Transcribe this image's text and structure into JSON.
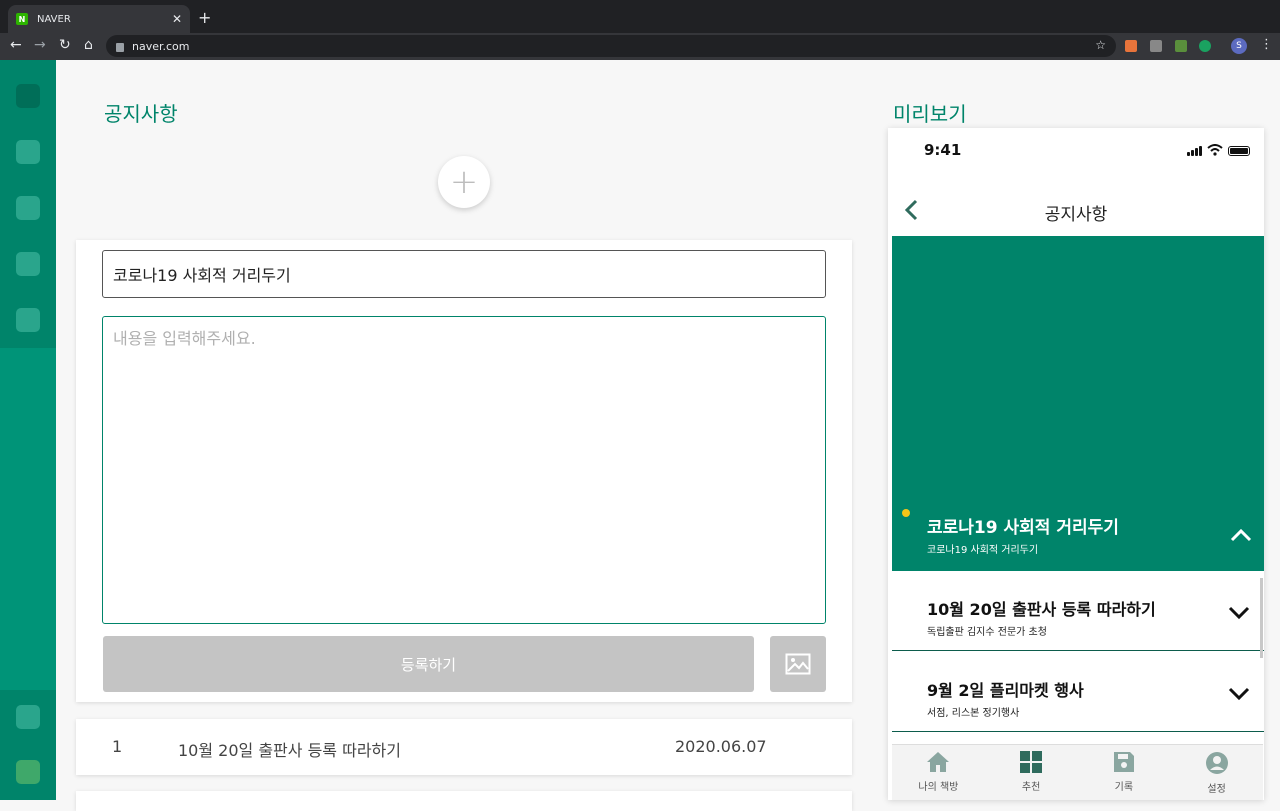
{
  "browser": {
    "tab_title": "NAVER",
    "url": "naver.com",
    "profile_initial": "S"
  },
  "main": {
    "section_title": "공지사항",
    "form": {
      "title_value": "코로나19 사회적 거리두기",
      "content_placeholder": "내용을 입력해주세요.",
      "submit_label": "등록하기"
    },
    "list": [
      {
        "no": "1",
        "title": "10월 20일 출판사 등록 따라하기",
        "date": "2020.06.07"
      }
    ]
  },
  "preview": {
    "section_title": "미리보기",
    "status_time": "9:41",
    "header_title": "공지사항",
    "expanded": {
      "title": "코로나19 사회적 거리두기",
      "subtitle": "코로나19 사회적 거리두기"
    },
    "items": [
      {
        "title": "10월 20일 출판사 등록 따라하기",
        "subtitle": "독립출판 김지수 전문가 초청"
      },
      {
        "title": "9월 2일 플리마켓 행사",
        "subtitle": "서점, 리스본 정기행사"
      }
    ],
    "bottom_tabs": [
      {
        "label": "나의 책방",
        "icon": "home-icon"
      },
      {
        "label": "추천",
        "icon": "grid-icon"
      },
      {
        "label": "기록",
        "icon": "save-icon"
      },
      {
        "label": "설정",
        "icon": "user-circle-icon"
      }
    ]
  },
  "colors": {
    "accent": "#00846a",
    "sidebar": "#009478",
    "dot": "#f5c518"
  }
}
